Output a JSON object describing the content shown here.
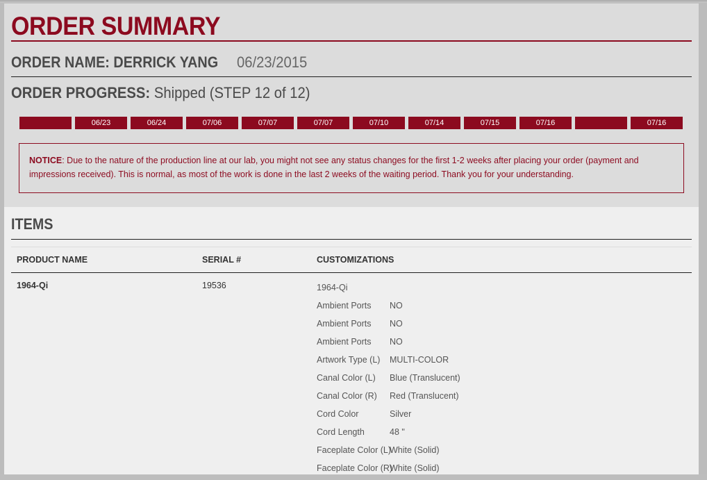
{
  "summary": {
    "title": "ORDER SUMMARY",
    "order_name_label": "ORDER NAME: DERRICK YANG",
    "order_date": "06/23/2015",
    "progress_label": "ORDER PROGRESS:",
    "progress_status": "Shipped (STEP 12 of 12)",
    "steps": [
      "",
      "06/23",
      "06/24",
      "07/06",
      "07/07",
      "07/07",
      "07/10",
      "07/14",
      "07/15",
      "07/16",
      "",
      "07/16"
    ],
    "notice_label": "NOTICE",
    "notice_text": ": Due to the nature of the production line at our lab, you might not see any status changes for the first 1-2 weeks after placing your order (payment and impressions received). This is normal, as most of the work is done in the last 2 weeks of the waiting period. Thank you for your understanding.",
    "accent_color": "#8c0a1f"
  },
  "items": {
    "title": "ITEMS",
    "columns": [
      "PRODUCT NAME",
      "SERIAL #",
      "CUSTOMIZATIONS"
    ],
    "rows": [
      {
        "product_name": "1964-Qi",
        "serial": "19536",
        "custom_header": "1964-Qi",
        "customizations": [
          {
            "key": "Ambient Ports",
            "value": "NO"
          },
          {
            "key": "Ambient Ports",
            "value": "NO"
          },
          {
            "key": "Ambient Ports",
            "value": "NO"
          },
          {
            "key": "Artwork Type (L)",
            "value": "MULTI-COLOR"
          },
          {
            "key": "Canal Color (L)",
            "value": "Blue (Translucent)"
          },
          {
            "key": "Canal Color (R)",
            "value": "Red (Translucent)"
          },
          {
            "key": "Cord Color",
            "value": "Silver"
          },
          {
            "key": "Cord Length",
            "value": "48 \""
          },
          {
            "key": "Faceplate Color (L)",
            "value": "White (Solid)"
          },
          {
            "key": "Faceplate Color (R)",
            "value": "White (Solid)"
          }
        ]
      }
    ]
  }
}
